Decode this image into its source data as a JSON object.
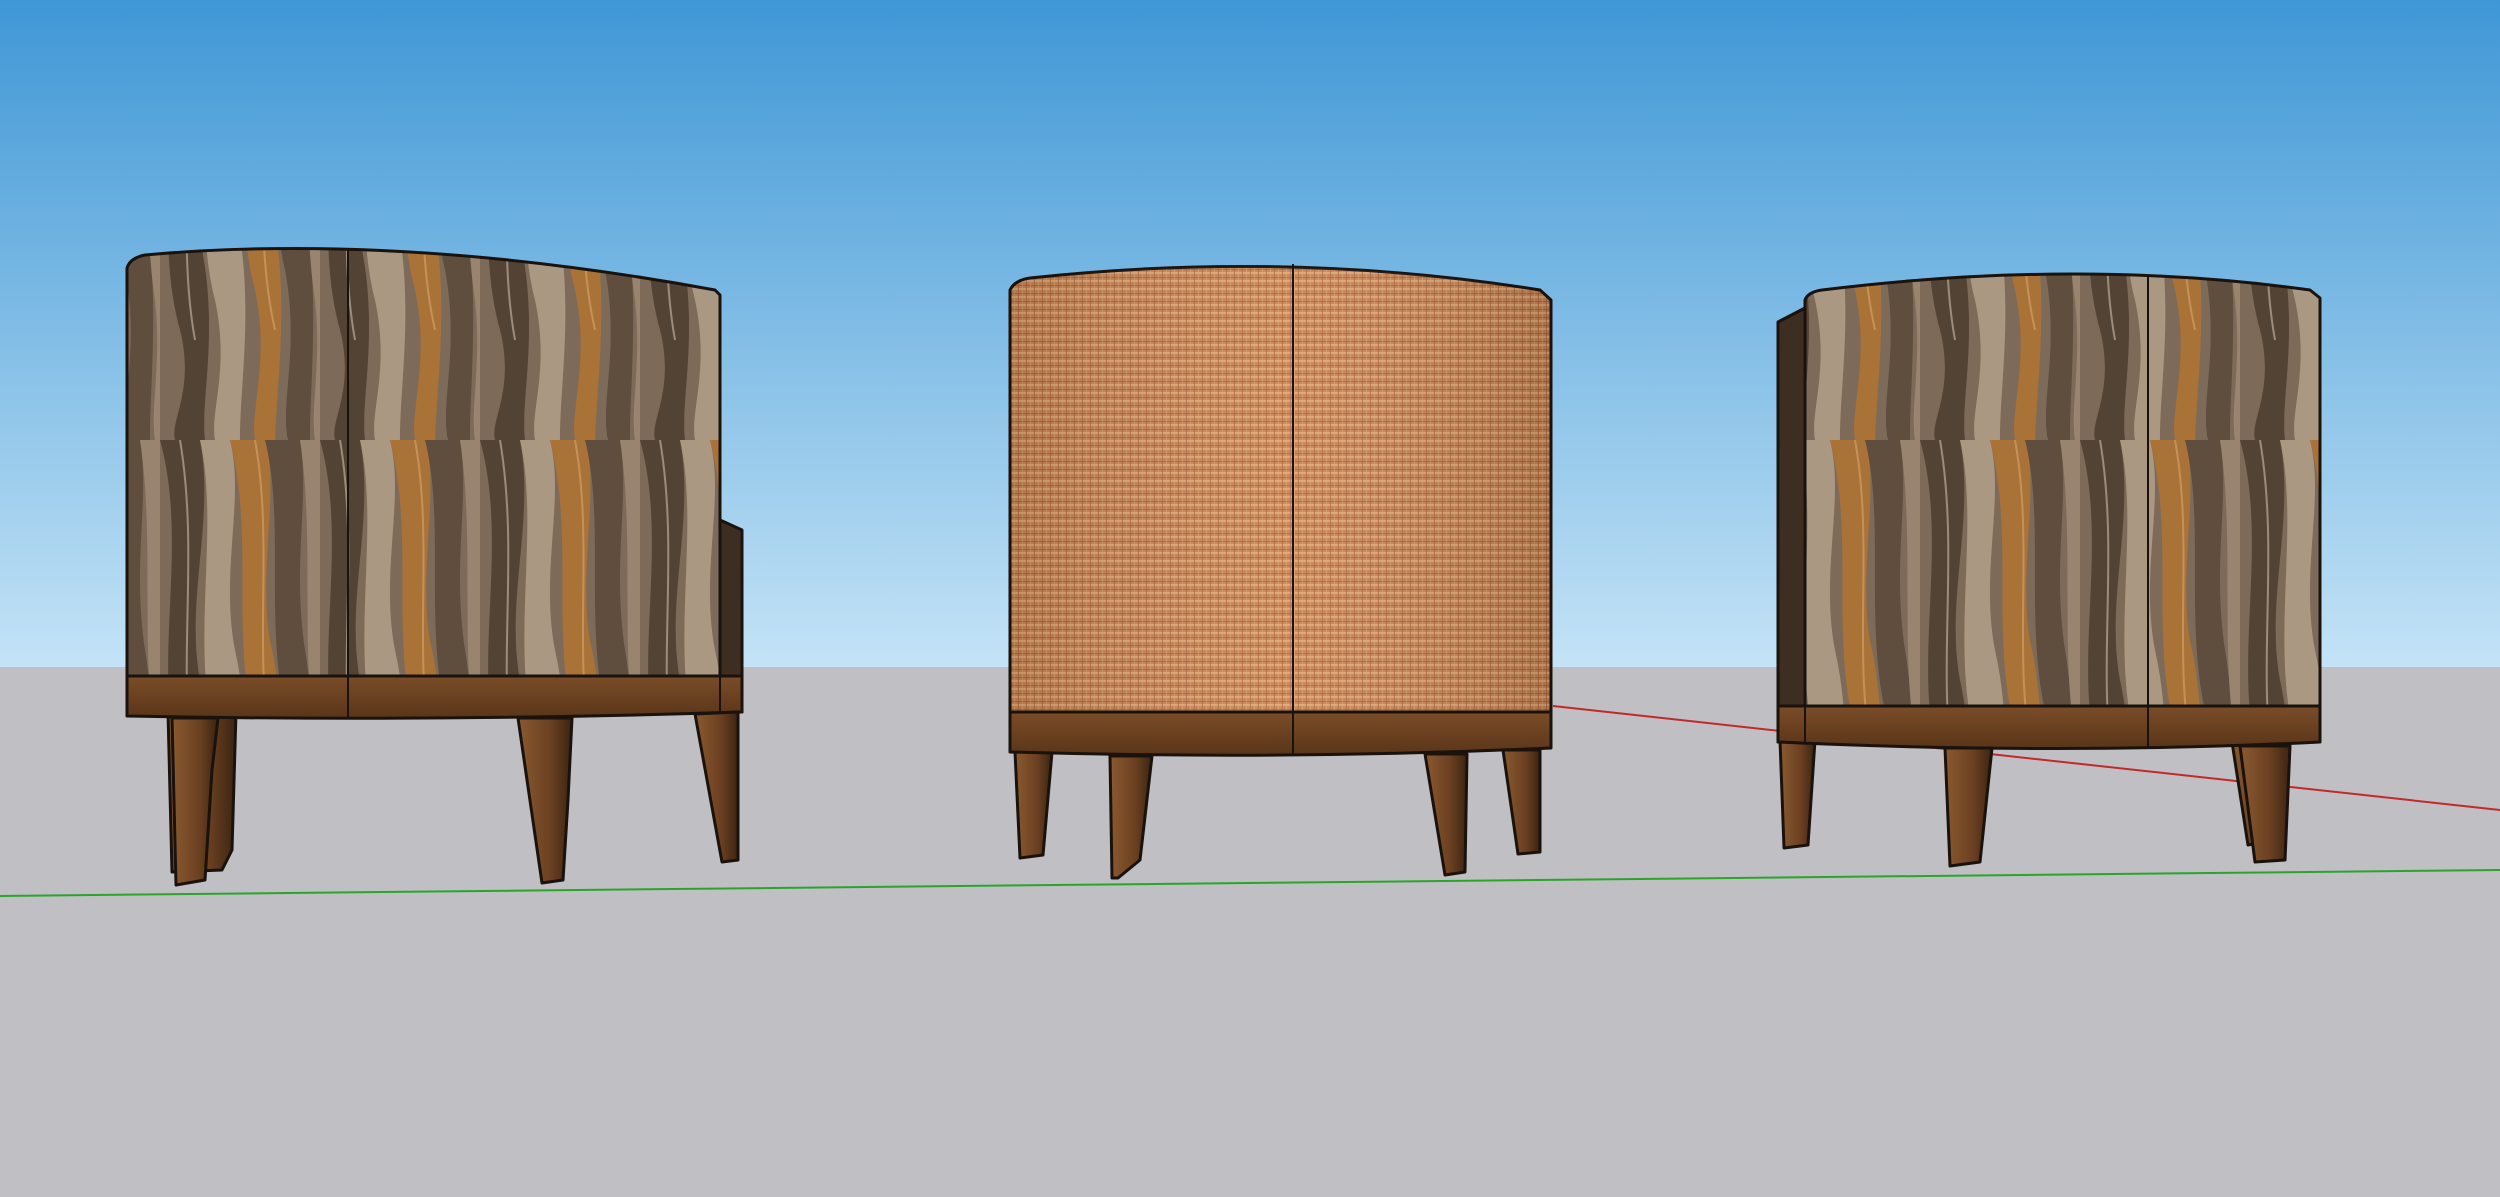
{
  "viewport": {
    "sky_colors": {
      "top": "#3f97d6",
      "bottom": "#c4e3f6"
    },
    "ground_color": "#c0bfc4",
    "axes": {
      "green_axis": {
        "color": "#2aa52a"
      },
      "red_axis": {
        "color": "#c02a2a"
      }
    }
  },
  "scene": {
    "objects": [
      {
        "name": "cabinet-left",
        "finish": "wavy-wood-grain",
        "legs": 4
      },
      {
        "name": "cabinet-center",
        "finish": "woven-cane",
        "legs": 4
      },
      {
        "name": "cabinet-right",
        "finish": "wavy-wood-grain",
        "legs": 4
      }
    ],
    "colors": {
      "outline": "#1a120c",
      "base_wood": "#6e4524",
      "base_wood_dark": "#4a2c15",
      "leg_light": "#7a4e2a",
      "leg_dark": "#3b2412",
      "wave_dark": "#5c4a3a",
      "wave_mid": "#8b7560",
      "wave_light": "#b3a08a",
      "wave_amber": "#b8742c",
      "cane_base": "#c98654",
      "cane_dark": "#a65a3a",
      "cane_light": "#e2ae7a"
    }
  }
}
